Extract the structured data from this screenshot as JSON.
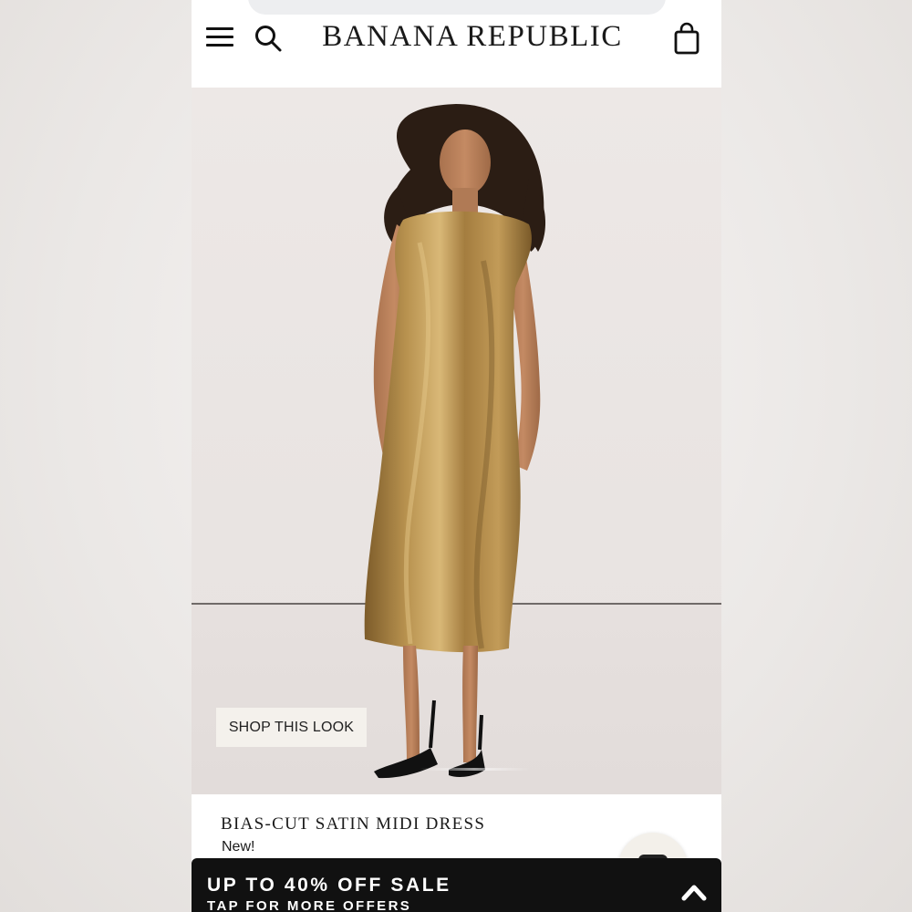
{
  "header": {
    "brand": "BANANA REPUBLIC",
    "menu_icon": "hamburger-menu-icon",
    "search_icon": "search-icon",
    "bag_icon": "shopping-bag-icon"
  },
  "hero": {
    "cta_label": "SHOP THIS LOOK"
  },
  "product": {
    "name": "BIAS-CUT SATIN MIDI DRESS",
    "badge": "New!"
  },
  "promo_banner": {
    "title": "UP TO 40% OFF SALE",
    "subtitle": "TAP FOR MORE OFFERS",
    "icon": "chevron-up-icon"
  },
  "colors": {
    "accent": "#111111",
    "dress": "#a07a3e",
    "cta_bg": "#f4f1ec"
  }
}
